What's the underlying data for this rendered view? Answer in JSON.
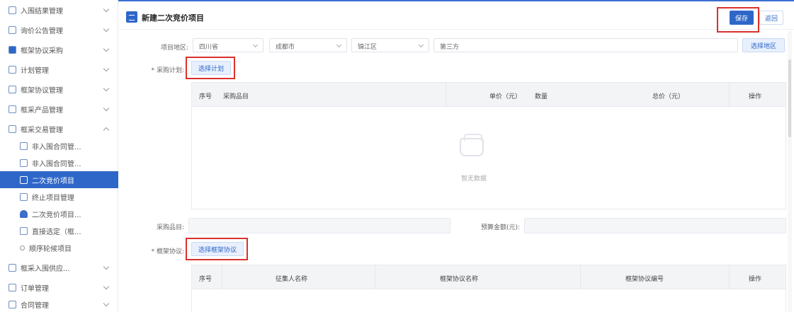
{
  "sidebar": {
    "items": [
      {
        "label": "入围结果管理"
      },
      {
        "label": "询价公告管理"
      },
      {
        "label": "框架协议采购"
      },
      {
        "label": "计划管理"
      },
      {
        "label": "框架协议管理"
      },
      {
        "label": "框采产品管理"
      },
      {
        "label": "框采交易管理"
      },
      {
        "label": "非入围合同管..."
      },
      {
        "label": "非入围合同管..."
      },
      {
        "label": "二次竞价项目"
      },
      {
        "label": "终止项目管理"
      },
      {
        "label": "二次竞价项目..."
      },
      {
        "label": "直接选定（框..."
      },
      {
        "label": "顺序轮候项目"
      },
      {
        "label": "框采入围供应..."
      },
      {
        "label": "订单管理"
      },
      {
        "label": "合同管理"
      }
    ]
  },
  "header": {
    "title": "新建二次竞价项目",
    "save_label": "保存",
    "back_label": "返回"
  },
  "form": {
    "region_label": "项目地区:",
    "region_selects": [
      {
        "value": "四川省"
      },
      {
        "value": "成都市"
      },
      {
        "value": "锦江区"
      },
      {
        "value": "第三方"
      }
    ],
    "region_button": "选择地区",
    "plan_label": "* 采购计划:",
    "plan_button": "选择计划",
    "plan_table": {
      "headers": [
        "序号",
        "采购品目",
        "单价（元）",
        "数量",
        "总价（元）",
        "操作"
      ],
      "empty_text": "暂无数据"
    },
    "item_label": "采购品目:",
    "budget_label": "预算金额(元):",
    "agreement_label": "* 框架协议:",
    "agreement_button": "选择框架协议",
    "agreement_table": {
      "headers": [
        "序号",
        "征集人名称",
        "框架协议名称",
        "框架协议编号",
        "操作"
      ]
    }
  },
  "colors": {
    "accent": "#2f67c9",
    "highlight_box": "#d9312c"
  }
}
